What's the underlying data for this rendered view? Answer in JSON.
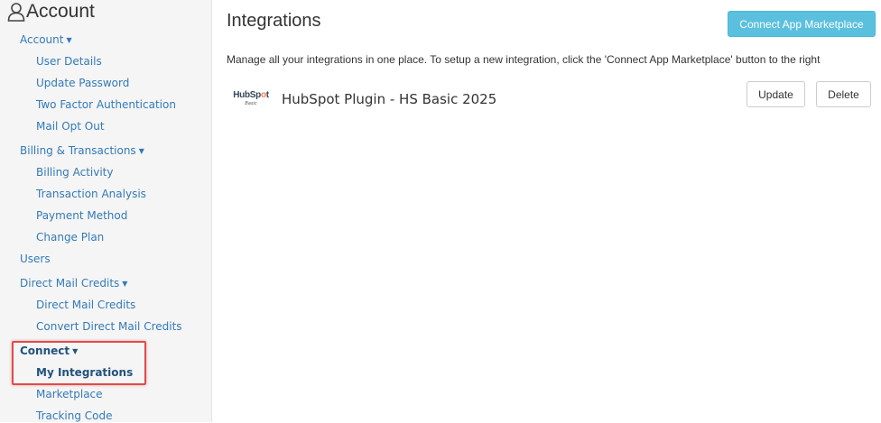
{
  "sidebar": {
    "title": "Account",
    "sections": [
      {
        "label": "Account",
        "items": [
          "User Details",
          "Update Password",
          "Two Factor Authentication",
          "Mail Opt Out"
        ]
      },
      {
        "label": "Billing & Transactions",
        "items": [
          "Billing Activity",
          "Transaction Analysis",
          "Payment Method",
          "Change Plan"
        ]
      },
      {
        "label": "Users"
      },
      {
        "label": "Direct Mail Credits",
        "items": [
          "Direct Mail Credits",
          "Convert Direct Mail Credits"
        ]
      },
      {
        "label": "Connect",
        "items": [
          "My Integrations",
          "Marketplace",
          "Tracking Code"
        ]
      }
    ]
  },
  "main": {
    "title": "Integrations",
    "connect_button": "Connect App Marketplace",
    "description": "Manage all your integrations in one place. To setup a new integration, click the 'Connect App Marketplace' button to the right",
    "integrations": [
      {
        "logo_text_a": "HubSp",
        "logo_text_o": "o",
        "logo_text_b": "t",
        "logo_sub": "Basic",
        "name": "HubSpot Plugin - HS Basic 2025",
        "update_label": "Update",
        "delete_label": "Delete"
      }
    ]
  },
  "colors": {
    "link": "#337ab7",
    "active_link": "#23527c",
    "info_button": "#5bc0de",
    "highlight": "#e04b4b",
    "hubspot_orange": "#ff7a59"
  }
}
